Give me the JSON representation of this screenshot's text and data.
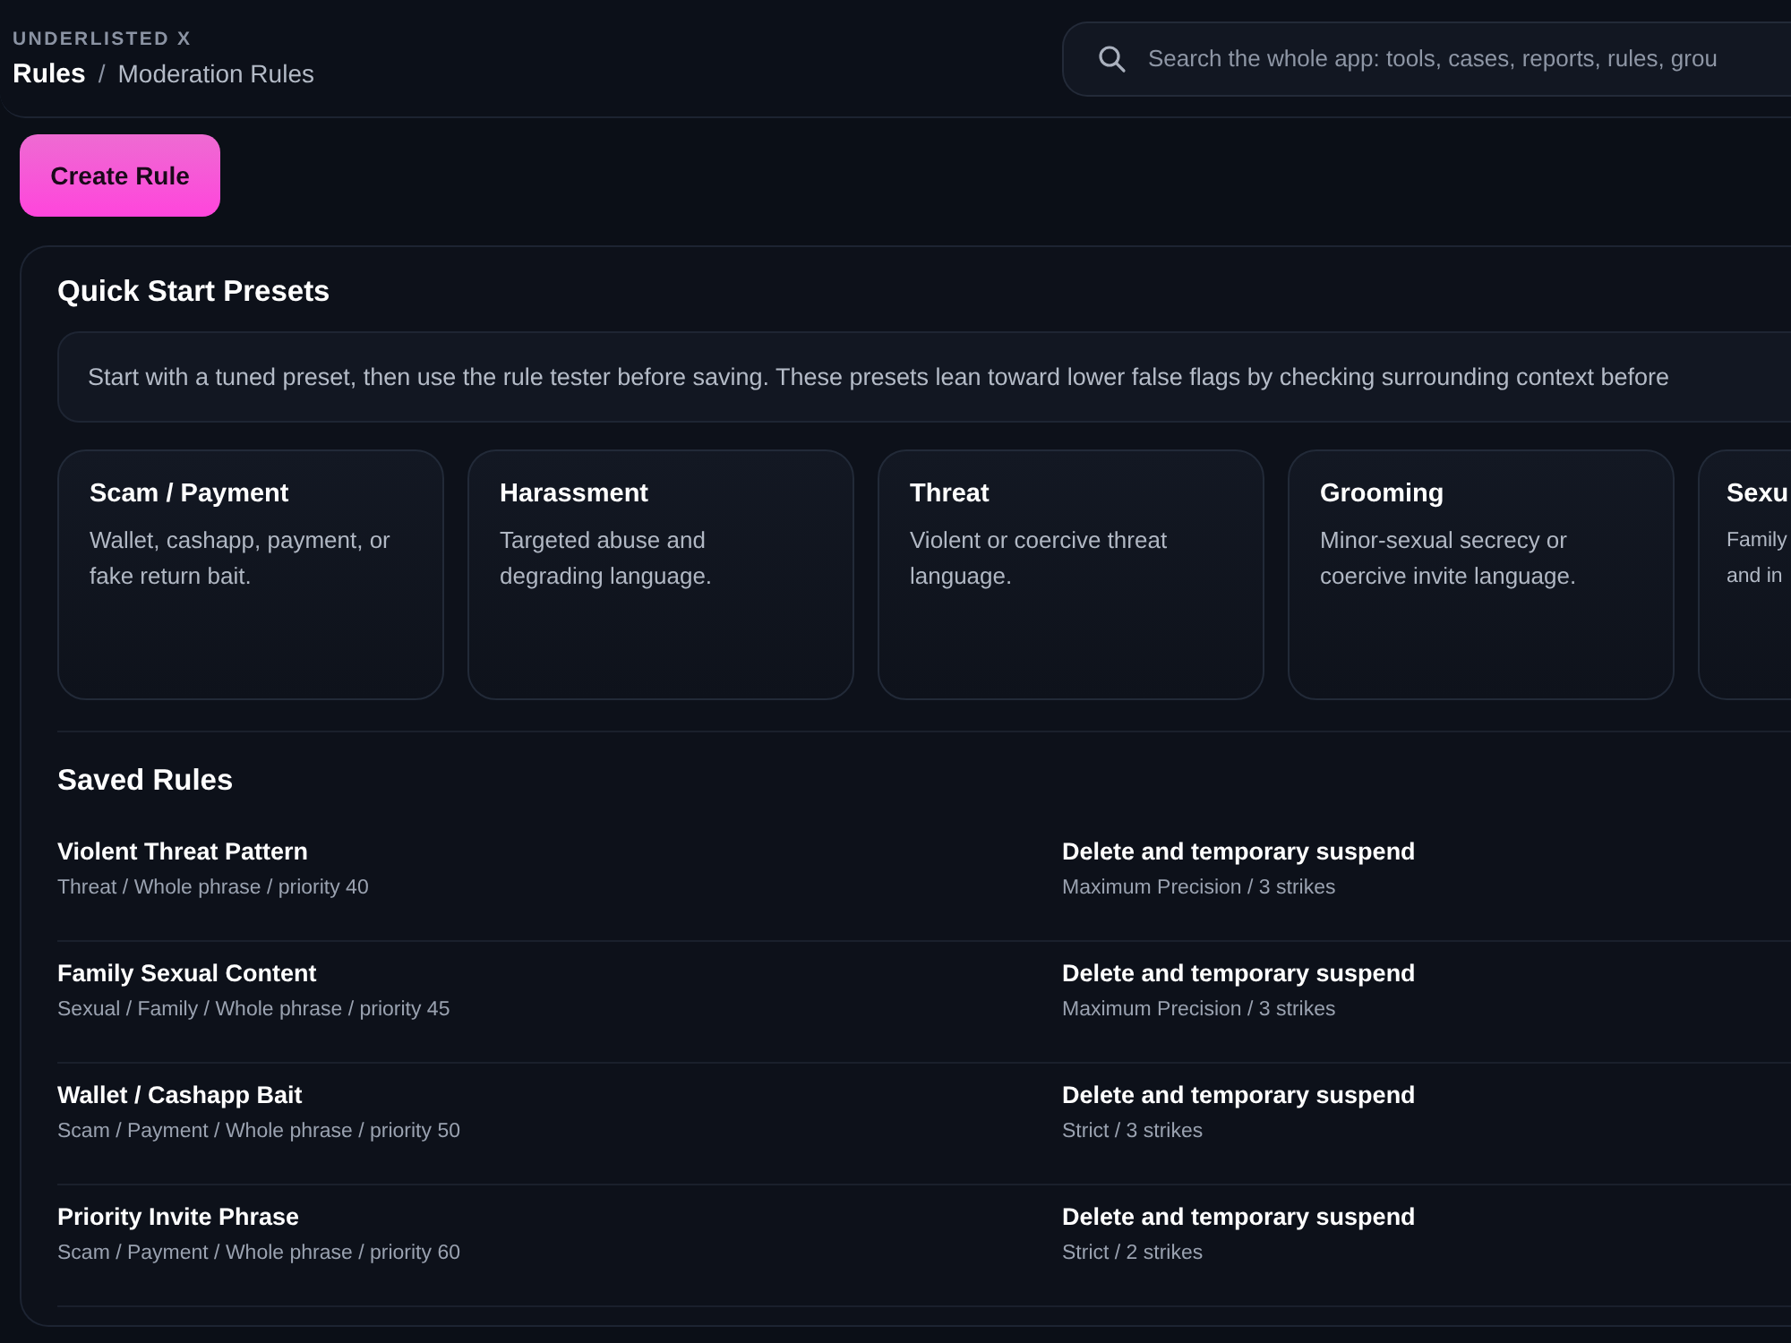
{
  "header": {
    "brand": "UNDERLISTED X",
    "breadcrumb": [
      {
        "label": "Rules",
        "current": true
      },
      {
        "label": "/",
        "kind": "separator"
      },
      {
        "label": "Moderation Rules",
        "current": false
      }
    ],
    "search": {
      "placeholder": "Search the whole app: tools, cases, reports, rules, grou"
    }
  },
  "create_button": "Create Rule",
  "presets": {
    "title": "Quick Start Presets",
    "intro": "Start with a tuned preset, then use the rule tester before saving. These presets lean toward lower false flags by checking surrounding context before",
    "cards": [
      {
        "title": "Scam / Payment",
        "description": "Wallet, cashapp, payment, or fake return bait."
      },
      {
        "title": "Harassment",
        "description": "Targeted abuse and degrading language."
      },
      {
        "title": "Threat",
        "description": "Violent or coercive threat language."
      },
      {
        "title": "Grooming",
        "description": "Minor-sexual secrecy or coercive invite language."
      },
      {
        "title": "Sexu",
        "description_lines": [
          "Family",
          "and in"
        ]
      }
    ]
  },
  "saved_rules": {
    "title": "Saved Rules",
    "rows": [
      {
        "name": "Violent Threat Pattern",
        "details": "Threat / Whole phrase / priority 40",
        "action": "Delete and temporary suspend",
        "policy": "Maximum Precision / 3 strikes"
      },
      {
        "name": "Family Sexual Content",
        "details": "Sexual / Family / Whole phrase / priority 45",
        "action": "Delete and temporary suspend",
        "policy": "Maximum Precision / 3 strikes"
      },
      {
        "name": "Wallet / Cashapp Bait",
        "details": "Scam / Payment / Whole phrase / priority 50",
        "action": "Delete and temporary suspend",
        "policy": "Strict / 3 strikes"
      },
      {
        "name": "Priority Invite Phrase",
        "details": "Scam / Payment / Whole phrase / priority 60",
        "action": "Delete and temporary suspend",
        "policy": "Strict / 2 strikes"
      }
    ]
  }
}
